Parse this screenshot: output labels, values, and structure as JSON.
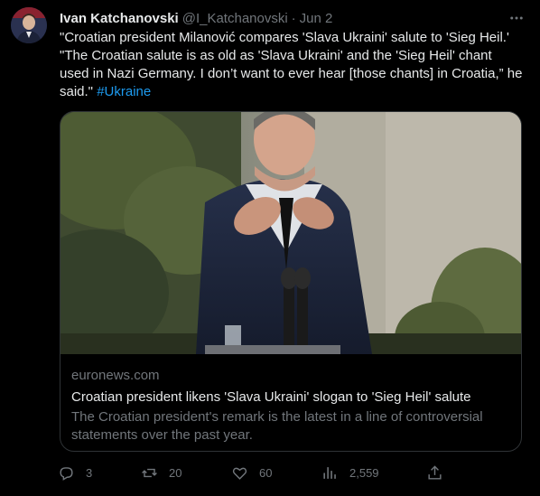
{
  "tweet": {
    "author_name": "Ivan Katchanovski",
    "author_handle": "@I_Katchanovski",
    "separator": "·",
    "date": "Jun 2",
    "text_main": "\"Croatian president Milanović compares 'Slava Ukraini' salute to 'Sieg Heil.' \"The Croatian salute is as old as 'Slava Ukraini' and the 'Sieg Heil' chant used in Nazi Germany. I don’t want to ever hear [those chants] in Croatia,” he said.\" ",
    "hashtag": "#Ukraine"
  },
  "card": {
    "domain": "euronews.com",
    "title": "Croatian president likens 'Slava Ukraini' slogan to 'Sieg Heil' salute",
    "description": "The Croatian president's remark is the latest in a line of controversial statements over the past year."
  },
  "actions": {
    "replies": "3",
    "reposts": "20",
    "likes": "60",
    "views": "2,559"
  },
  "icons": {
    "more": "more-icon",
    "reply": "reply-icon",
    "repost": "repost-icon",
    "like": "heart-icon",
    "views": "views-icon",
    "share": "share-icon"
  },
  "colors": {
    "background": "#000000",
    "text": "#e7e9ea",
    "muted": "#71767b",
    "link": "#1d9bf0",
    "border": "#2f3336"
  }
}
